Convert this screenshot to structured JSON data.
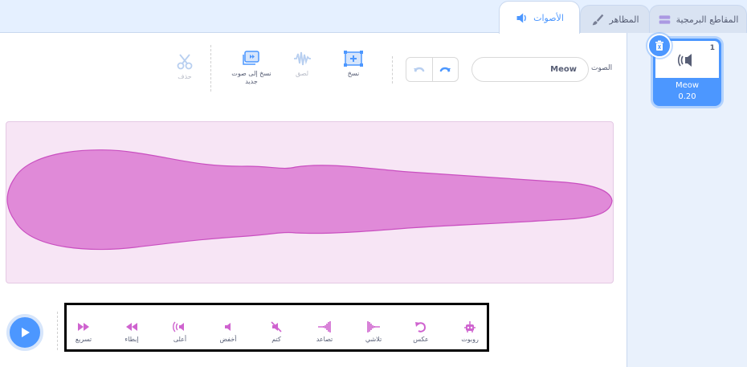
{
  "tabs": {
    "code": "المقاطع البرمجية",
    "costumes": "المظاهر",
    "sounds": "الأصوات"
  },
  "colors": {
    "accent": "#4c97ff",
    "wave_fill": "#e08ad8",
    "wave_stroke": "#c94fc0",
    "effect_icon": "#cf63cf"
  },
  "editor": {
    "sound_label": "الصوت",
    "sound_name": "Meow",
    "tools": {
      "copy": "نسخ",
      "paste": "لصق",
      "copy_to_new": "نسخ إلى صوت جديد",
      "delete": "حذف"
    }
  },
  "sound_list": [
    {
      "index": "1",
      "name": "Meow",
      "duration": "0.20"
    }
  ],
  "effects": [
    {
      "label": "روبوت",
      "icon": "robot-icon"
    },
    {
      "label": "عكس",
      "icon": "reverse-icon"
    },
    {
      "label": "تلاشي",
      "icon": "fade-out-icon"
    },
    {
      "label": "تصاعد",
      "icon": "fade-in-icon"
    },
    {
      "label": "كتم",
      "icon": "mute-icon"
    },
    {
      "label": "أخفض",
      "icon": "softer-icon"
    },
    {
      "label": "أعلى",
      "icon": "louder-icon"
    },
    {
      "label": "إبطاء",
      "icon": "slower-icon"
    },
    {
      "label": "تسريع",
      "icon": "faster-icon"
    }
  ]
}
